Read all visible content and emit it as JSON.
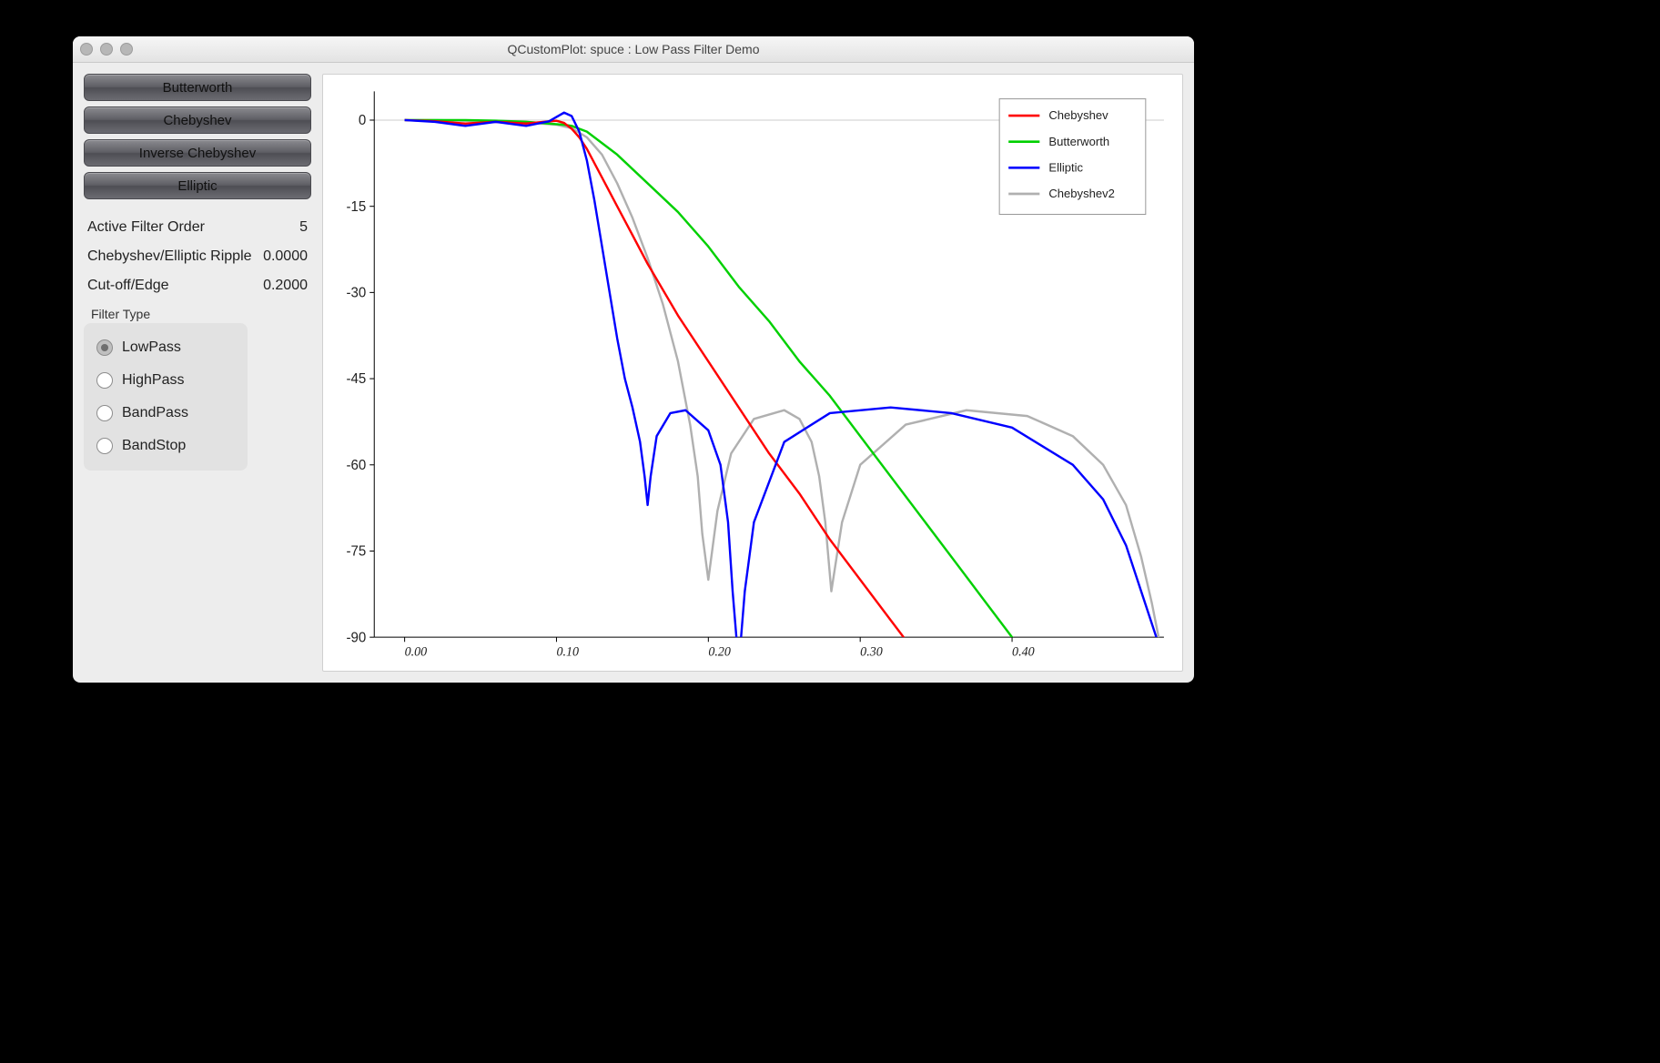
{
  "window": {
    "title": "QCustomPlot: spuce : Low Pass Filter Demo"
  },
  "sidebar": {
    "buttons": [
      "Butterworth",
      "Chebyshev",
      "Inverse Chebyshev",
      "Elliptic"
    ],
    "params": {
      "order": {
        "label": "Active Filter Order",
        "value": "5"
      },
      "ripple": {
        "label": "Chebyshev/Elliptic Ripple",
        "value": "0.0000"
      },
      "cutoff": {
        "label": "Cut-off/Edge",
        "value": "0.2000"
      }
    },
    "filter_type": {
      "title": "Filter Type",
      "options": [
        "LowPass",
        "HighPass",
        "BandPass",
        "BandStop"
      ],
      "selected": "LowPass"
    }
  },
  "chart_data": {
    "type": "line",
    "xlabel": "",
    "ylabel": "",
    "xlim": [
      -0.02,
      0.5
    ],
    "ylim": [
      -90,
      5
    ],
    "xticks": [
      0.0,
      0.1,
      0.2,
      0.3,
      0.4
    ],
    "yticks": [
      0,
      -15,
      -30,
      -45,
      -60,
      -75,
      -90
    ],
    "legend": {
      "position": "top-right",
      "entries": [
        "Chebyshev",
        "Butterworth",
        "Elliptic",
        "Chebyshev2"
      ]
    },
    "colors": {
      "Chebyshev": "#ff0000",
      "Butterworth": "#00d000",
      "Elliptic": "#0000ff",
      "Chebyshev2": "#b0b0b0"
    },
    "series": [
      {
        "name": "Butterworth",
        "x": [
          0.0,
          0.02,
          0.04,
          0.06,
          0.08,
          0.1,
          0.105,
          0.11,
          0.12,
          0.13,
          0.14,
          0.16,
          0.18,
          0.2,
          0.22,
          0.24,
          0.26,
          0.28,
          0.3,
          0.32,
          0.34,
          0.36,
          0.38,
          0.4,
          0.42
        ],
        "y": [
          0,
          0,
          0,
          -0.1,
          -0.3,
          -0.7,
          -0.8,
          -1.0,
          -2.0,
          -4.0,
          -6.0,
          -11,
          -16,
          -22,
          -29,
          -35,
          -42,
          -48,
          -55,
          -62,
          -69,
          -76,
          -83,
          -90,
          -97
        ]
      },
      {
        "name": "Chebyshev",
        "x": [
          0.0,
          0.02,
          0.04,
          0.06,
          0.08,
          0.1,
          0.105,
          0.11,
          0.115,
          0.12,
          0.13,
          0.14,
          0.15,
          0.16,
          0.18,
          0.2,
          0.22,
          0.24,
          0.26,
          0.28,
          0.3,
          0.32,
          0.34,
          0.35
        ],
        "y": [
          0,
          -0.2,
          -0.6,
          -0.3,
          -0.6,
          -0.1,
          -0.5,
          -1.5,
          -3.0,
          -5.0,
          -10,
          -15,
          -20,
          -25,
          -34,
          -42,
          -50,
          -58,
          -65,
          -73,
          -80,
          -87,
          -94,
          -98
        ]
      },
      {
        "name": "Elliptic",
        "x": [
          0.0,
          0.02,
          0.04,
          0.06,
          0.08,
          0.095,
          0.105,
          0.11,
          0.115,
          0.12,
          0.125,
          0.13,
          0.135,
          0.14,
          0.145,
          0.15,
          0.155,
          0.158,
          0.16,
          0.162,
          0.166,
          0.175,
          0.185,
          0.2,
          0.208,
          0.213,
          0.216,
          0.22,
          0.224,
          0.23,
          0.25,
          0.28,
          0.32,
          0.36,
          0.4,
          0.44,
          0.46,
          0.475,
          0.485,
          0.495
        ],
        "y": [
          0,
          -0.3,
          -1.0,
          -0.3,
          -1.0,
          -0.2,
          1.3,
          0.7,
          -2,
          -7,
          -14,
          -22,
          -30,
          -38,
          -45,
          -50,
          -56,
          -62,
          -67,
          -62,
          -55,
          -51,
          -50.5,
          -54,
          -60,
          -70,
          -82,
          -95,
          -82,
          -70,
          -56,
          -51,
          -50,
          -51,
          -53.5,
          -60,
          -66,
          -74,
          -82,
          -90
        ]
      },
      {
        "name": "Chebyshev2",
        "x": [
          0.0,
          0.02,
          0.04,
          0.06,
          0.08,
          0.1,
          0.11,
          0.12,
          0.13,
          0.14,
          0.15,
          0.16,
          0.17,
          0.18,
          0.188,
          0.193,
          0.196,
          0.2,
          0.206,
          0.215,
          0.23,
          0.25,
          0.26,
          0.268,
          0.273,
          0.277,
          0.281,
          0.288,
          0.3,
          0.33,
          0.37,
          0.41,
          0.44,
          0.46,
          0.475,
          0.485,
          0.492,
          0.498
        ],
        "y": [
          0,
          0,
          -0.1,
          -0.2,
          -0.4,
          -0.8,
          -1.4,
          -3,
          -6,
          -11,
          -17,
          -24,
          -32,
          -42,
          -53,
          -62,
          -72,
          -80,
          -68,
          -58,
          -52,
          -50.5,
          -52,
          -56,
          -62,
          -70,
          -82,
          -70,
          -60,
          -53,
          -50.5,
          -51.5,
          -55,
          -60,
          -67,
          -76,
          -84,
          -92
        ]
      }
    ]
  }
}
